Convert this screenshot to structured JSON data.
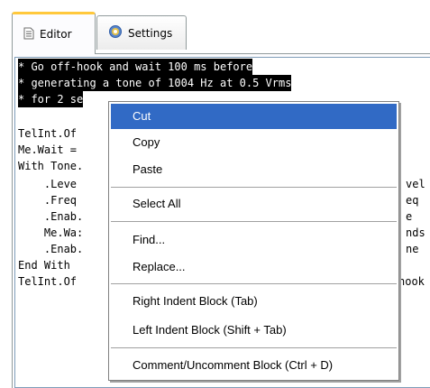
{
  "tabs": [
    {
      "label": "Editor",
      "icon": "document-icon"
    },
    {
      "label": "Settings",
      "icon": "gear-icon"
    }
  ],
  "code": {
    "lines": [
      "* Go off-hook and wait 100 ms before",
      "* generating a tone of 1004 Hz at 0.5 Vrms",
      "* for 2 se",
      "",
      "TelInt.Of",
      "Me.Wait =",
      "With Tone.",
      "    .Leve",
      "    .Freq",
      "    .Enab.",
      "    Me.Wa:",
      "    .Enab.",
      "End With",
      "TelInt.Of"
    ],
    "right_fragments": [
      "vel",
      "eq",
      "e",
      "nds",
      "ne",
      "",
      "hook"
    ],
    "selected_lines": 3
  },
  "context_menu": {
    "items": [
      {
        "label": "Cut",
        "highlighted": true
      },
      {
        "label": "Copy"
      },
      {
        "label": "Paste"
      },
      {
        "label": "Select All"
      },
      {
        "label": "Find..."
      },
      {
        "label": "Replace..."
      },
      {
        "label": "Right Indent Block (Tab)"
      },
      {
        "label": "Left Indent Block (Shift + Tab)"
      },
      {
        "label": "Comment/Uncomment Block (Ctrl + D)"
      }
    ]
  },
  "colors": {
    "highlight": "#316ac5",
    "selection": "#000000",
    "tab_accent": "#ffc83c",
    "border": "#919b9c"
  }
}
